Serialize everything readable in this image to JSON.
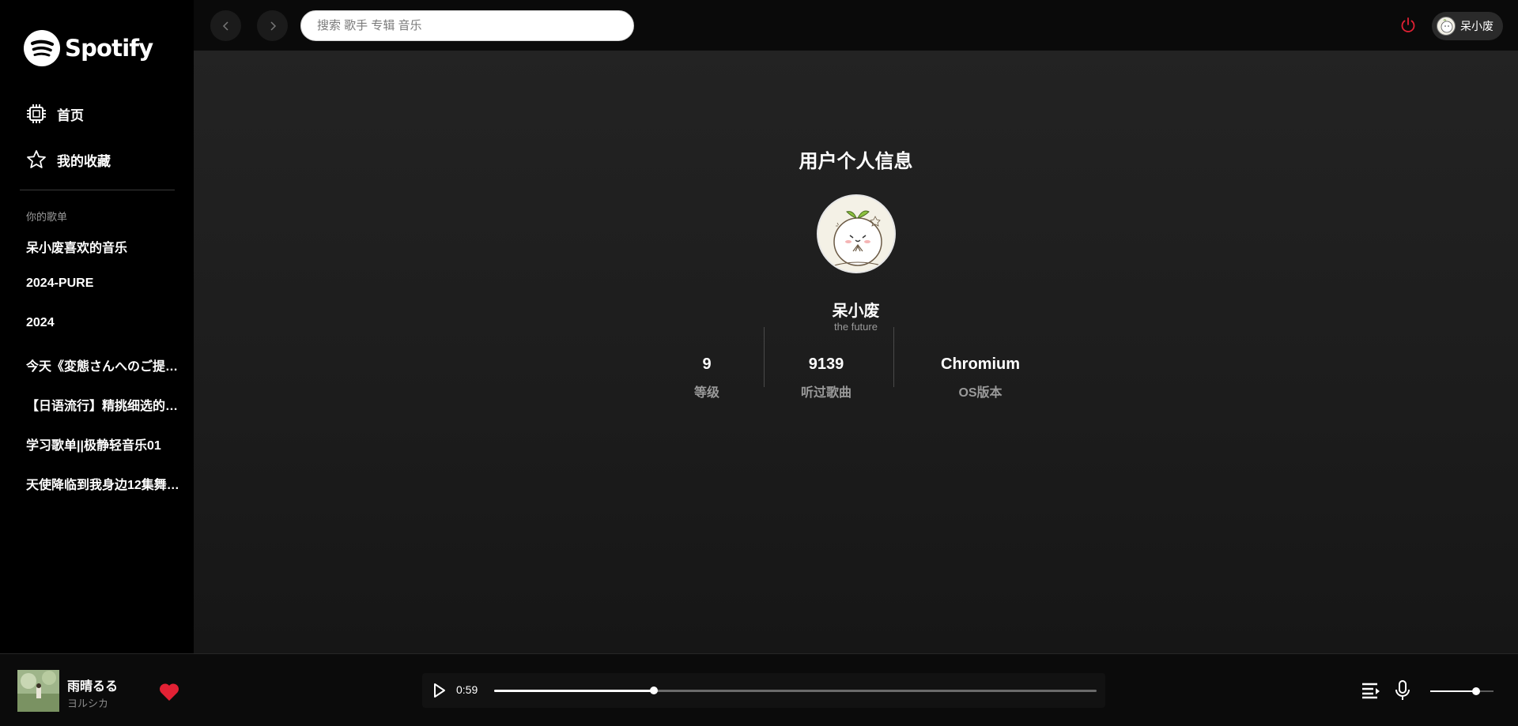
{
  "app": {
    "name": "Spotify"
  },
  "sidebar": {
    "nav": [
      {
        "label": "首页",
        "icon": "chip-icon"
      },
      {
        "label": "我的收藏",
        "icon": "star-icon"
      }
    ],
    "section_label": "你的歌单",
    "playlists": [
      "呆小废喜欢的音乐",
      "2024-PURE",
      "2024",
      "今天《変態さんへのご提…",
      "【日语流行】精挑细选的…",
      "学习歌单||极静轻音乐01",
      "天使降临到我身边12集舞…"
    ]
  },
  "topbar": {
    "search_placeholder": "搜索 歌手 专辑 音乐",
    "user_name": "呆小废",
    "power_color": "#e22134"
  },
  "profile": {
    "title": "用户个人信息",
    "username": "呆小废",
    "signature": "the future",
    "stats": [
      {
        "value": "9",
        "label": "等级"
      },
      {
        "value": "9139",
        "label": "听过歌曲"
      },
      {
        "value": "Chromium",
        "label": "OS版本"
      }
    ]
  },
  "player": {
    "track_title": "雨晴るる",
    "track_artist": "ヨルシカ",
    "current_time": "0:59",
    "progress_fraction": 0.265,
    "volume_fraction": 0.72,
    "liked": true,
    "heart_color": "#e22134"
  }
}
